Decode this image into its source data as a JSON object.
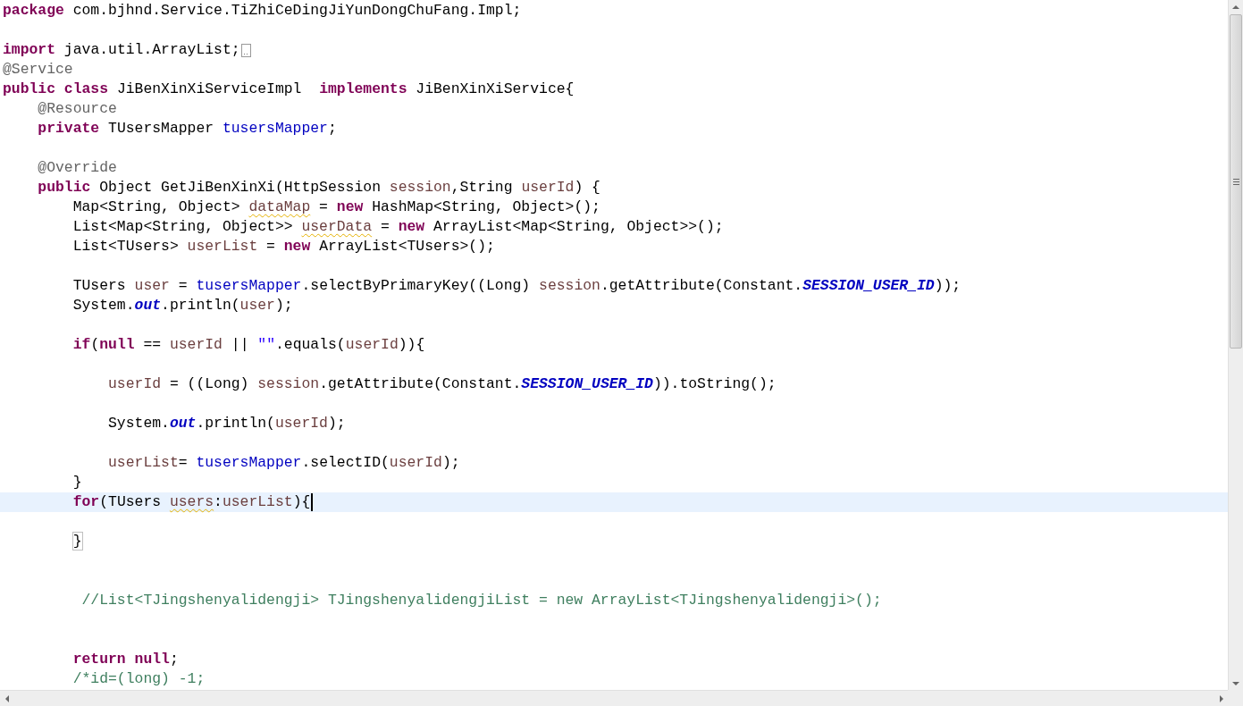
{
  "editor": {
    "lines": [
      {
        "current": false,
        "folded": false,
        "tokens": [
          {
            "text": "package",
            "kind": "keyword"
          },
          {
            "text": " com.bjhnd.Service.TiZhiCeDingJiYunDongChuFang.Impl;",
            "kind": "plain"
          }
        ]
      },
      {
        "current": false,
        "folded": false
      },
      {
        "current": false,
        "folded": true,
        "tokens": [
          {
            "text": "import",
            "kind": "keyword"
          },
          {
            "text": " java.util.ArrayList;",
            "kind": "plain"
          }
        ]
      },
      {
        "current": false,
        "folded": false,
        "tokens": [
          {
            "text": "@Service",
            "kind": "annotation"
          }
        ]
      },
      {
        "current": false,
        "folded": false,
        "tokens": [
          {
            "text": "public class",
            "kind": "keyword"
          },
          {
            "text": " JiBenXinXiServiceImpl  ",
            "kind": "plain"
          },
          {
            "text": "implements",
            "kind": "keyword"
          },
          {
            "text": " JiBenXinXiService{",
            "kind": "plain"
          }
        ]
      },
      {
        "current": false,
        "folded": false,
        "tokens": [
          {
            "text": "    @Resource",
            "kind": "annotation"
          }
        ]
      },
      {
        "current": false,
        "folded": false,
        "tokens": [
          {
            "text": "    private",
            "kind": "keyword"
          },
          {
            "text": " TUsersMapper ",
            "kind": "plain"
          },
          {
            "text": "tusersMapper",
            "kind": "field"
          },
          {
            "text": ";",
            "kind": "plain"
          }
        ]
      },
      {
        "current": false,
        "folded": false
      },
      {
        "current": false,
        "folded": false,
        "tokens": [
          {
            "text": "    @Override",
            "kind": "annotation"
          }
        ]
      },
      {
        "current": false,
        "folded": false,
        "tokens": [
          {
            "text": "    public",
            "kind": "keyword"
          },
          {
            "text": " Object GetJiBenXinXi(HttpSession ",
            "kind": "plain"
          },
          {
            "text": "session",
            "kind": "local"
          },
          {
            "text": ",String ",
            "kind": "plain"
          },
          {
            "text": "userId",
            "kind": "local"
          },
          {
            "text": ") {",
            "kind": "plain"
          }
        ]
      },
      {
        "current": false,
        "folded": false,
        "tokens": [
          {
            "text": "        Map<String, Object> ",
            "kind": "plain"
          },
          {
            "text": "dataMap",
            "kind": "local",
            "warning": true
          },
          {
            "text": " = ",
            "kind": "plain"
          },
          {
            "text": "new",
            "kind": "keyword"
          },
          {
            "text": " HashMap<String, Object>();",
            "kind": "plain"
          }
        ]
      },
      {
        "current": false,
        "folded": false,
        "tokens": [
          {
            "text": "        List<Map<String, Object>> ",
            "kind": "plain"
          },
          {
            "text": "userData",
            "kind": "local",
            "warning": true
          },
          {
            "text": " = ",
            "kind": "plain"
          },
          {
            "text": "new",
            "kind": "keyword"
          },
          {
            "text": " ArrayList<Map<String, Object>>();",
            "kind": "plain"
          }
        ]
      },
      {
        "current": false,
        "folded": false,
        "tokens": [
          {
            "text": "        List<TUsers> ",
            "kind": "plain"
          },
          {
            "text": "userList",
            "kind": "local"
          },
          {
            "text": " = ",
            "kind": "plain"
          },
          {
            "text": "new",
            "kind": "keyword"
          },
          {
            "text": " ArrayList<TUsers>();",
            "kind": "plain"
          }
        ]
      },
      {
        "current": false,
        "folded": false
      },
      {
        "current": false,
        "folded": false,
        "tokens": [
          {
            "text": "        TUsers ",
            "kind": "plain"
          },
          {
            "text": "user",
            "kind": "local"
          },
          {
            "text": " = ",
            "kind": "plain"
          },
          {
            "text": "tusersMapper",
            "kind": "field"
          },
          {
            "text": ".selectByPrimaryKey((Long) ",
            "kind": "plain"
          },
          {
            "text": "session",
            "kind": "local"
          },
          {
            "text": ".getAttribute(Constant.",
            "kind": "plain"
          },
          {
            "text": "SESSION_USER_ID",
            "kind": "static"
          },
          {
            "text": "));",
            "kind": "plain"
          }
        ]
      },
      {
        "current": false,
        "folded": false,
        "tokens": [
          {
            "text": "        System.",
            "kind": "plain"
          },
          {
            "text": "out",
            "kind": "static"
          },
          {
            "text": ".println(",
            "kind": "plain"
          },
          {
            "text": "user",
            "kind": "local"
          },
          {
            "text": ");",
            "kind": "plain"
          }
        ]
      },
      {
        "current": false,
        "folded": false
      },
      {
        "current": false,
        "folded": false,
        "tokens": [
          {
            "text": "        if",
            "kind": "keyword"
          },
          {
            "text": "(",
            "kind": "plain"
          },
          {
            "text": "null",
            "kind": "keyword"
          },
          {
            "text": " == ",
            "kind": "plain"
          },
          {
            "text": "userId",
            "kind": "local"
          },
          {
            "text": " || ",
            "kind": "plain"
          },
          {
            "text": "\"\"",
            "kind": "string"
          },
          {
            "text": ".equals(",
            "kind": "plain"
          },
          {
            "text": "userId",
            "kind": "local"
          },
          {
            "text": ")){",
            "kind": "plain"
          }
        ]
      },
      {
        "current": false,
        "folded": false
      },
      {
        "current": false,
        "folded": false,
        "tokens": [
          {
            "text": "            userId",
            "kind": "local"
          },
          {
            "text": " = ((Long) ",
            "kind": "plain"
          },
          {
            "text": "session",
            "kind": "local"
          },
          {
            "text": ".getAttribute(Constant.",
            "kind": "plain"
          },
          {
            "text": "SESSION_USER_ID",
            "kind": "static"
          },
          {
            "text": ")).toString();",
            "kind": "plain"
          }
        ]
      },
      {
        "current": false,
        "folded": false
      },
      {
        "current": false,
        "folded": false,
        "tokens": [
          {
            "text": "            System.",
            "kind": "plain"
          },
          {
            "text": "out",
            "kind": "static"
          },
          {
            "text": ".println(",
            "kind": "plain"
          },
          {
            "text": "userId",
            "kind": "local"
          },
          {
            "text": ");",
            "kind": "plain"
          }
        ]
      },
      {
        "current": false,
        "folded": false
      },
      {
        "current": false,
        "folded": false,
        "tokens": [
          {
            "text": "            userList",
            "kind": "local"
          },
          {
            "text": "= ",
            "kind": "plain"
          },
          {
            "text": "tusersMapper",
            "kind": "field"
          },
          {
            "text": ".selectID(",
            "kind": "plain"
          },
          {
            "text": "userId",
            "kind": "local"
          },
          {
            "text": ");",
            "kind": "plain"
          }
        ]
      },
      {
        "current": false,
        "folded": false,
        "tokens": [
          {
            "text": "        }",
            "kind": "plain"
          }
        ]
      },
      {
        "current": true,
        "folded": false,
        "tokens": [
          {
            "text": "        for",
            "kind": "keyword"
          },
          {
            "text": "(TUsers ",
            "kind": "plain"
          },
          {
            "text": "users",
            "kind": "local",
            "warning": true
          },
          {
            "text": ":",
            "kind": "plain"
          },
          {
            "text": "userList",
            "kind": "local"
          },
          {
            "text": "){",
            "kind": "plain"
          }
        ]
      },
      {
        "current": false,
        "folded": false
      },
      {
        "current": false,
        "folded": false,
        "tokens": [
          {
            "text": "        }",
            "kind": "plain",
            "matched": true
          }
        ]
      },
      {
        "current": false,
        "folded": false
      },
      {
        "current": false,
        "folded": false
      },
      {
        "current": false,
        "folded": false,
        "tokens": [
          {
            "text": "         //List<TJingshenyalidengji> TJingshenyalidengjiList = new ArrayList<TJingshenyalidengji>();",
            "kind": "comment"
          }
        ]
      },
      {
        "current": false,
        "folded": false
      },
      {
        "current": false,
        "folded": false
      },
      {
        "current": false,
        "folded": false,
        "tokens": [
          {
            "text": "        return null",
            "kind": "keyword"
          },
          {
            "text": ";",
            "kind": "plain"
          }
        ]
      },
      {
        "current": false,
        "folded": false,
        "tokens": [
          {
            "text": "        /*id=(long) -1;",
            "kind": "comment"
          }
        ]
      }
    ]
  }
}
